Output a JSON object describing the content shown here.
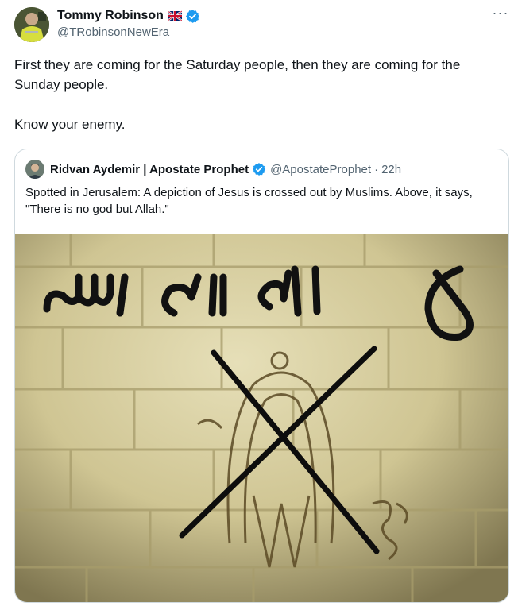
{
  "author": {
    "display_name": "Tommy Robinson",
    "handle": "@TRobinsonNewEra",
    "flag_icon": "uk-flag-icon",
    "verified_icon": "verified-badge-icon",
    "verified_color": "#1d9bf0"
  },
  "more_label": "···",
  "tweet_text": "First they are coming for the Saturday people, then they are coming for the Sunday people.\n\nKnow your enemy.",
  "quote": {
    "display_name": "Ridvan Aydemir | Apostate Prophet",
    "handle": "@ApostateProphet",
    "separator": "·",
    "time": "22h",
    "text": "Spotted in Jerusalem: A depiction of Jesus is crossed out by Muslims. Above, it says, \"There is no god but Allah.\"",
    "photo_graffiti": "لا إله إلا الله"
  },
  "colors": {
    "text": "#0f1419",
    "secondary": "#536471",
    "border": "#cfd9de"
  }
}
